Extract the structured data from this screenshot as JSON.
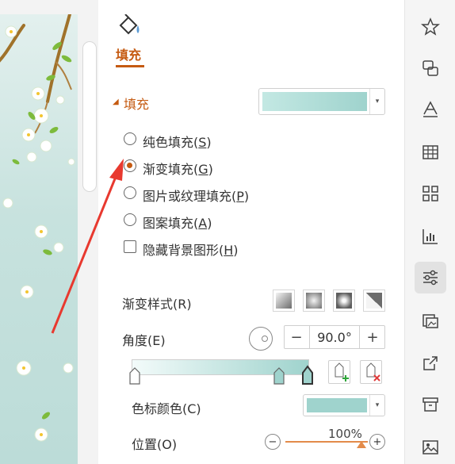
{
  "tab": {
    "label": "填充"
  },
  "section": {
    "label": "填充",
    "color_fill": "#a9dbd6"
  },
  "fill_options": [
    {
      "label": "纯色填充(",
      "key": "S",
      "end": ")",
      "selected": false
    },
    {
      "label": "渐变填充(",
      "key": "G",
      "end": ")",
      "selected": true
    },
    {
      "label": "图片或纹理填充(",
      "key": "P",
      "end": ")",
      "selected": false
    },
    {
      "label": "图案填充(",
      "key": "A",
      "end": ")",
      "selected": false
    }
  ],
  "hide_background": {
    "label": "隐藏背景图形(",
    "key": "H",
    "end": ")",
    "checked": false
  },
  "gradient_style": {
    "label": "渐变样式(R)"
  },
  "angle": {
    "label": "角度(E)",
    "value": "90.0°",
    "minus": "−",
    "plus": "+"
  },
  "stop_color": {
    "label": "色标颜色(C)",
    "color": "#9fd3cd"
  },
  "position": {
    "label": "位置(O)",
    "value": "100%",
    "fraction": 1.0,
    "minus": "−",
    "plus": "+"
  },
  "colors": {
    "accent": "#c55a11",
    "annotation_arrow": "#e8392f"
  },
  "sidebar_icons": [
    "star-shape-icon",
    "shape-link-icon",
    "text-fill-icon",
    "table-icon",
    "grid-apps-icon",
    "bar-chart-icon",
    "adjust-settings-icon",
    "picture-frame-icon",
    "share-export-icon",
    "archive-box-icon",
    "image-icon"
  ]
}
